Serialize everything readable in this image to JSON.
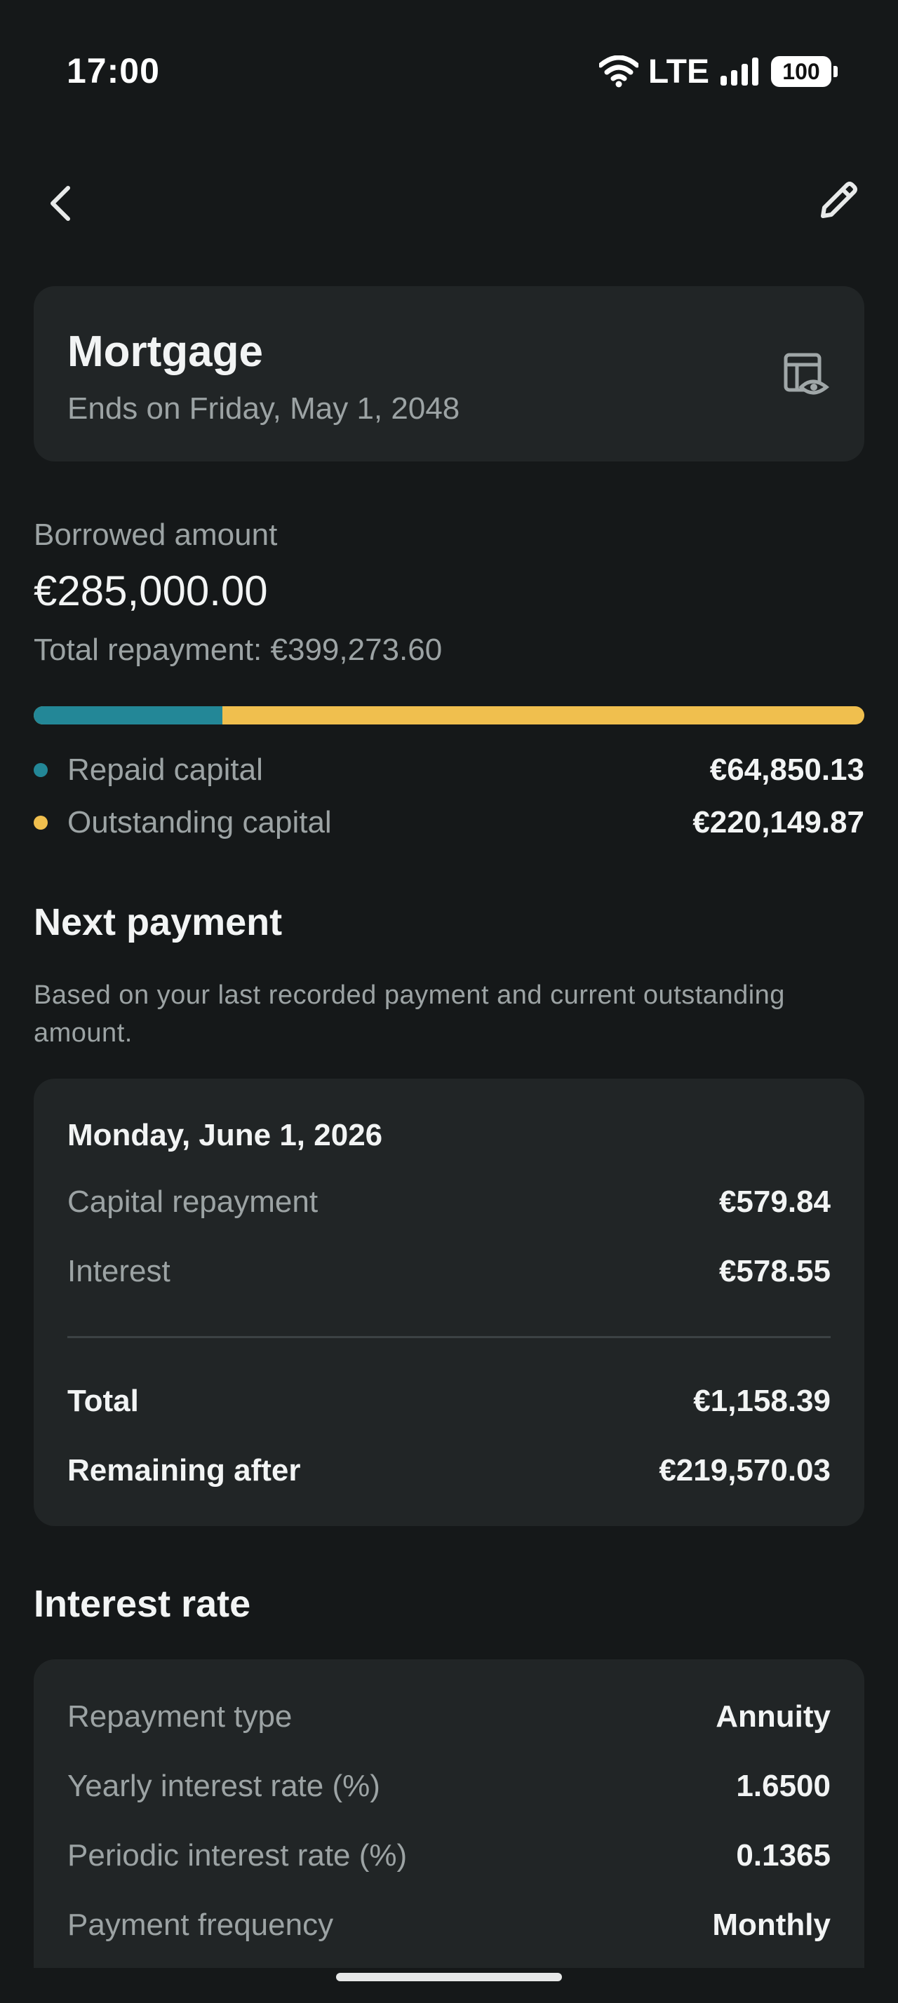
{
  "status_bar": {
    "time": "17:00",
    "network": "LTE",
    "battery": "100"
  },
  "toolbar": {
    "back_icon": "chevron-left-icon",
    "edit_icon": "pencil-icon"
  },
  "loan": {
    "title": "Mortgage",
    "ends_on": "Ends on Friday, May 1, 2048",
    "schedule_icon": "table-eye-icon"
  },
  "borrowed": {
    "label": "Borrowed amount",
    "value": "€285,000.00",
    "total_repayment": "Total repayment: €399,273.60",
    "repaid_fraction": 0.2275
  },
  "legend": {
    "repaid_label": "Repaid capital",
    "repaid_value": "€64,850.13",
    "repaid_color": "#238797",
    "outstanding_label": "Outstanding capital",
    "outstanding_value": "€220,149.87",
    "outstanding_color": "#f0bf4e"
  },
  "next_payment": {
    "title": "Next payment",
    "description": "Based on your last recorded payment and current outstanding amount.",
    "date": "Monday, June 1, 2026",
    "capital_label": "Capital repayment",
    "capital_value": "€579.84",
    "interest_label": "Interest",
    "interest_value": "€578.55",
    "total_label": "Total",
    "total_value": "€1,158.39",
    "remaining_label": "Remaining after",
    "remaining_value": "€219,570.03"
  },
  "interest_rate": {
    "title": "Interest rate",
    "repayment_type_label": "Repayment type",
    "repayment_type_value": "Annuity",
    "yearly_label": "Yearly interest rate (%)",
    "yearly_value": "1.6500",
    "periodic_label": "Periodic interest rate (%)",
    "periodic_value": "0.1365",
    "frequency_label": "Payment frequency",
    "frequency_value": "Monthly"
  }
}
